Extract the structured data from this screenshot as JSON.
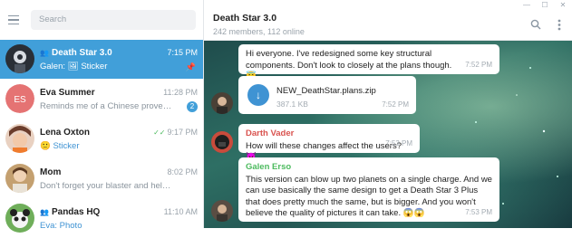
{
  "search": {
    "placeholder": "Search"
  },
  "chat_list": [
    {
      "name": "Death Star 3.0",
      "time": "7:15 PM",
      "preview_prefix": "Galen: ",
      "preview_blue": "Sticker",
      "group": true,
      "active": true,
      "pinned": true
    },
    {
      "name": "Eva Summer",
      "time": "11:28 PM",
      "preview_text": "Reminds me of a Chinese prove…",
      "badge": "2",
      "initials": "ES"
    },
    {
      "name": "Lena Oxton",
      "time": "9:17 PM",
      "preview_blue": "Sticker",
      "read_ticks": "✓✓"
    },
    {
      "name": "Mom",
      "time": "8:02 PM",
      "preview_text": "Don't forget your blaster and helmet"
    },
    {
      "name": "Pandas HQ",
      "time": "11:10 AM",
      "preview_blue": "Eva: Photo",
      "group": true
    }
  ],
  "header": {
    "title": "Death Star 3.0",
    "subtitle": "242 members, 112 online"
  },
  "messages": [
    {
      "text": "Hi everyone. I've redesigned some key structural components. Don't look to closely at the plans though. 😇",
      "time": "7:52 PM"
    },
    {
      "file_name": "NEW_DeathStar.plans.zip",
      "file_size": "387.1 KB",
      "time": "7:52 PM"
    },
    {
      "sender": "Darth Vader",
      "sender_color": "#d9534f",
      "text": "How will these changes affect the users? 😈",
      "time": "7:53 PM"
    },
    {
      "sender": "Galen Erso",
      "sender_color": "#4dbb5f",
      "text": "This version can blow up two planets on a single charge. And we can use basically the same design to get a Death Star 3 Plus that does pretty much the same, but is bigger. And you won't believe the quality of pictures it can take. 😱😱",
      "time": "7:53 PM"
    }
  ],
  "colors": {
    "accent": "#419fd9",
    "badge": "#419fd9",
    "read": "#4dbb5f"
  }
}
